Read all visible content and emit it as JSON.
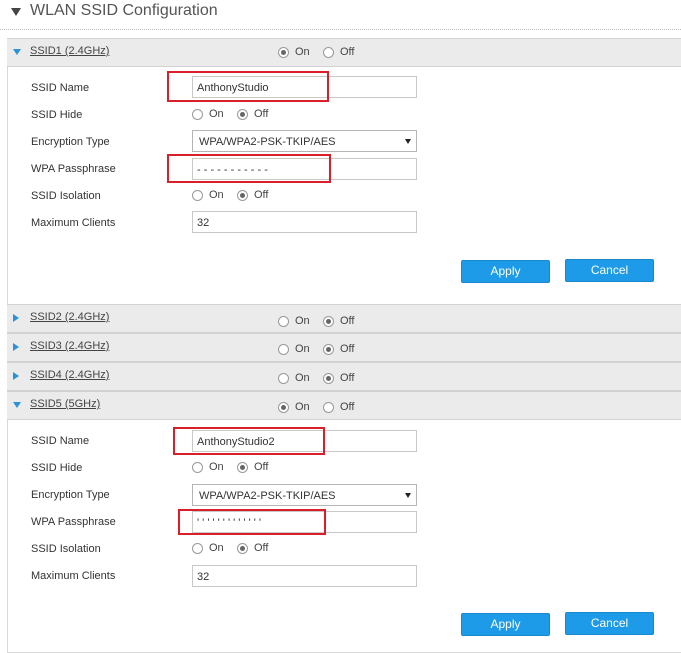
{
  "page": {
    "title": "WLAN SSID Configuration"
  },
  "labels": {
    "ssid_name": "SSID Name",
    "ssid_hide": "SSID Hide",
    "encryption_type": "Encryption Type",
    "wpa_passphrase": "WPA Passphrase",
    "ssid_isolation": "SSID Isolation",
    "max_clients": "Maximum Clients",
    "on": "On",
    "off": "Off"
  },
  "ssids": [
    {
      "name": "SSID1 (2.4GHz)",
      "expanded": true,
      "state": "On",
      "ssid_name": "AnthonyStudio",
      "hide": "Off",
      "encryption": "WPA/WPA2-PSK-TKIP/AES",
      "passphrase_mask": "- - - - - - - - - - -",
      "isolation": "Off",
      "max_clients": "32",
      "apply_label": "Apply",
      "cancel_label": "Cancel"
    },
    {
      "name": "SSID2 (2.4GHz)",
      "expanded": false,
      "state": "Off"
    },
    {
      "name": "SSID3 (2.4GHz)",
      "expanded": false,
      "state": "Off"
    },
    {
      "name": "SSID4 (2.4GHz)",
      "expanded": false,
      "state": "Off"
    },
    {
      "name": "SSID5 (5GHz)",
      "expanded": true,
      "state": "On",
      "ssid_name": "AnthonyStudio2",
      "hide": "Off",
      "encryption": "WPA/WPA2-PSK-TKIP/AES",
      "passphrase_mask": "' ' ' ' ' ' ' ' ' ' ' ' '",
      "isolation": "Off",
      "max_clients": "32",
      "apply_label": "Apply",
      "cancel_label": "Cancel"
    }
  ],
  "colors": {
    "accent": "#1e9be8",
    "highlight": "#d91f2a",
    "header_bg": "#ebebeb"
  }
}
